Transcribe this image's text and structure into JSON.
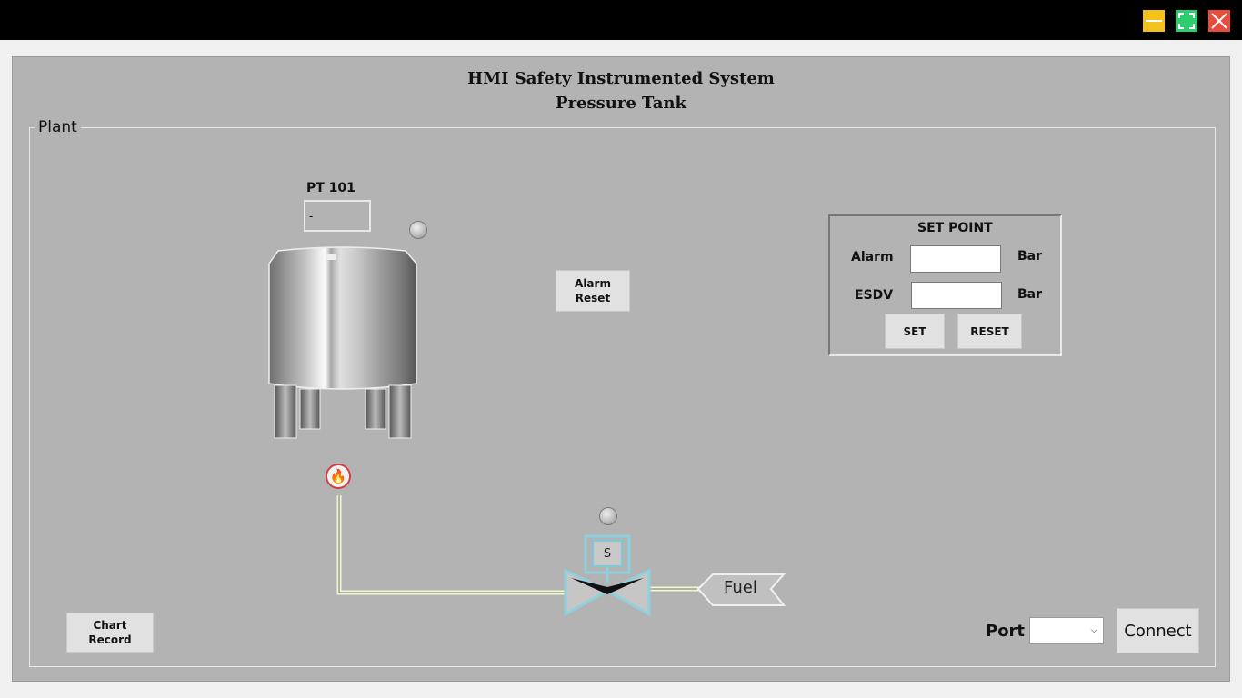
{
  "window": {
    "title_line1": "HMI Safety Instrumented System",
    "title_line2": "Pressure Tank"
  },
  "plant": {
    "group_label": "Plant",
    "sensor_label": "PT 101",
    "sensor_value": "-",
    "alarm_reset_label": "Alarm\nReset",
    "fuel_label": "Fuel",
    "solenoid_label": "S"
  },
  "setpoint": {
    "title": "SET POINT",
    "alarm_label": "Alarm",
    "esdv_label": "ESDV",
    "unit_alarm": "Bar",
    "unit_esdv": "Bar",
    "alarm_value": "",
    "esdv_value": "",
    "set_label": "SET",
    "reset_label": "RESET"
  },
  "bottom": {
    "chart_record_label": "Chart\nRecord",
    "port_label": "Port",
    "port_value": "",
    "connect_label": "Connect"
  },
  "icons": {
    "minimize": "minimize-icon",
    "maximize": "maximize-icon",
    "close": "close-icon",
    "fire": "flame-icon"
  },
  "colors": {
    "panel": "#b3b3b3",
    "minimize": "#f3c21b",
    "maximize": "#2ecc71",
    "close": "#e74c3c"
  }
}
